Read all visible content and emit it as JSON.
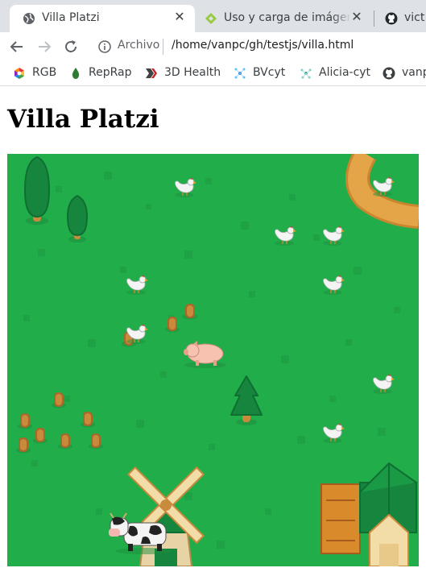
{
  "tabs": [
    {
      "title": "Villa Platzi",
      "icon": "globe-icon",
      "active": true
    },
    {
      "title": "Uso y carga de imágenes",
      "icon": "platzi-icon",
      "active": false
    },
    {
      "title": "vict",
      "icon": "github-icon",
      "active": false
    }
  ],
  "toolbar": {
    "scheme_label": "Archivo",
    "url": "/home/vanpc/gh/testjs/villa.html"
  },
  "bookmarks": [
    {
      "label": "RGB",
      "icon": "rgb-hexagon-icon"
    },
    {
      "label": "RepRap",
      "icon": "reprap-drop-icon"
    },
    {
      "label": "3D Health",
      "icon": "3dhealth-icon"
    },
    {
      "label": "BVcyt",
      "icon": "bvcyt-icon"
    },
    {
      "label": "Alicia-cyt",
      "icon": "alicia-icon"
    },
    {
      "label": "vanp",
      "icon": "github-icon"
    }
  ],
  "page": {
    "heading": "Villa Platzi"
  },
  "colors": {
    "grass": "#22ad4b",
    "path": "#e0a442",
    "tree": "#16853d"
  }
}
